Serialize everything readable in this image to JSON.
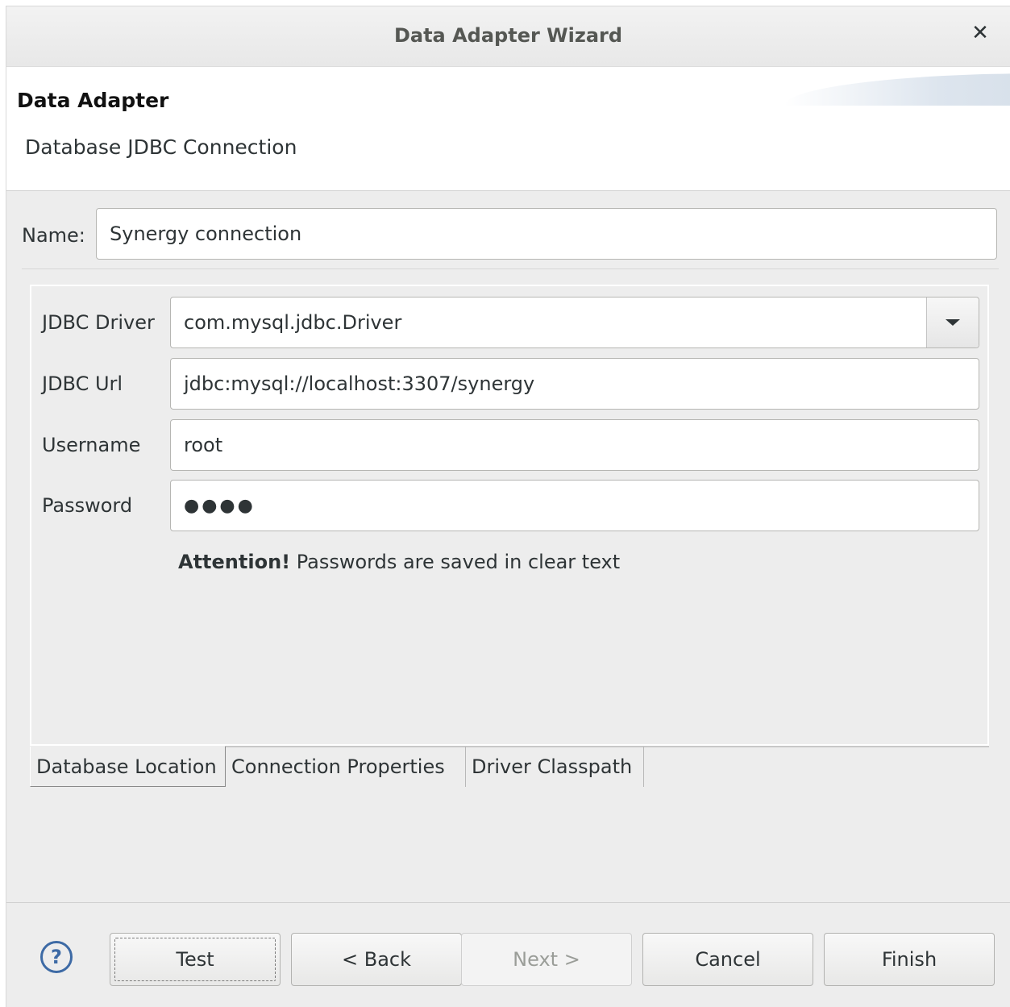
{
  "window": {
    "title": "Data Adapter Wizard",
    "close_glyph": "✕"
  },
  "header": {
    "title": "Data Adapter",
    "description": "Database JDBC Connection"
  },
  "name": {
    "label": "Name:",
    "value": "Synergy connection"
  },
  "fields": {
    "driver_label": "JDBC Driver",
    "driver_value": "com.mysql.jdbc.Driver",
    "url_label": "JDBC Url",
    "url_value": "jdbc:mysql://localhost:3307/synergy",
    "username_label": "Username",
    "username_value": "root",
    "password_label": "Password",
    "password_masked": "●●●●"
  },
  "attention": {
    "strong": "Attention!",
    "text": " Passwords are saved in clear text"
  },
  "tabs": [
    {
      "label": "Database Location",
      "active": true
    },
    {
      "label": "Connection Properties",
      "active": false
    },
    {
      "label": "Driver Classpath",
      "active": false
    }
  ],
  "buttons": {
    "help": "?",
    "test": "Test",
    "back": "< Back",
    "next": "Next >",
    "cancel": "Cancel",
    "finish": "Finish"
  },
  "icons": {
    "help": "help-icon",
    "close": "close-icon",
    "dropdown": "chevron-down-icon"
  },
  "colors": {
    "help_accent": "#3d6aa5",
    "disabled_text": "#9a9d98"
  }
}
